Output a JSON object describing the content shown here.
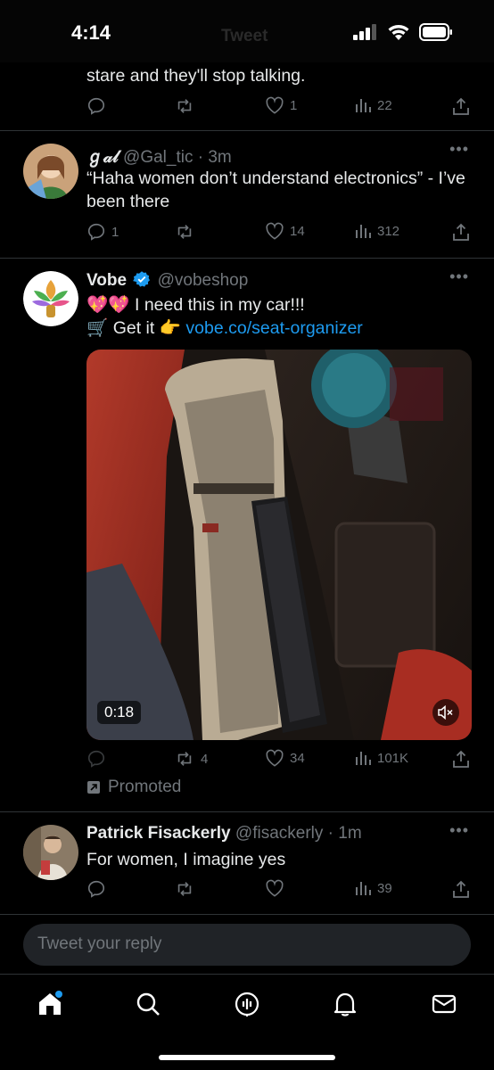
{
  "status_bar": {
    "time": "4:14",
    "ghost_title": "Tweet"
  },
  "tweets": [
    {
      "text": "stare and they'll stop talking.",
      "stats": {
        "replies": "",
        "retweets": "",
        "likes": "1",
        "views": "22"
      }
    },
    {
      "display_name": "ℊ𝒶𝓁",
      "handle": "@Gal_tic",
      "time": "· 3m",
      "text": "“Haha women don’t understand electronics” - I’ve been there",
      "stats": {
        "replies": "1",
        "retweets": "",
        "likes": "14",
        "views": "312"
      }
    },
    {
      "display_name": "Vobe",
      "handle": "@vobeshop",
      "line1_emoji": "💖💖",
      "line1_text": " I need this in my car!!!",
      "line2_emoji": "🛒",
      "line2_text": " Get it ",
      "line2_pointer": "👉",
      "link": "vobe.co/seat-organizer",
      "video_duration": "0:18",
      "stats": {
        "replies": "",
        "retweets": "4",
        "likes": "34",
        "views": "101K"
      },
      "promoted_label": "Promoted"
    },
    {
      "display_name": "Patrick Fisackerly",
      "handle": "@fisackerly",
      "time": "· 1m",
      "text": "For women, I imagine yes",
      "stats": {
        "replies": "",
        "retweets": "",
        "likes": "",
        "views": "39"
      }
    }
  ],
  "reply_box": {
    "placeholder": "Tweet your reply"
  },
  "colors": {
    "background": "#000000",
    "accent": "#1d9bf0",
    "muted": "#71767b",
    "text": "#e7e9ea",
    "verified": "#1d9bf0"
  },
  "tab_bar": {
    "items": [
      "home-icon",
      "search-icon",
      "spaces-icon",
      "notifications-icon",
      "messages-icon"
    ]
  }
}
